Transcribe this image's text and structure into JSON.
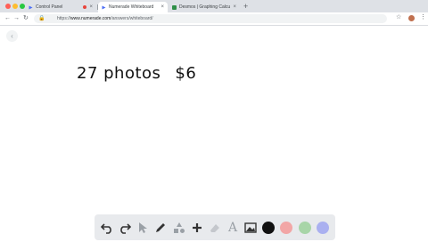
{
  "browser": {
    "tabs": [
      {
        "label": "Control Panel",
        "active": false,
        "dot": true
      },
      {
        "label": "Numerade Whiteboard",
        "active": true,
        "dot": false
      },
      {
        "label": "Desmos | Graphing Calculator",
        "active": false,
        "dot": false
      }
    ],
    "close_glyph": "×",
    "new_tab_glyph": "+",
    "url_prefix": "https://",
    "url_host": "www.numerade.com",
    "url_path": "/answers/whiteboard/",
    "colors": {
      "tabbar": "#dee1e6",
      "numerade_blue": "#4c6ef5",
      "desmos_green": "#2f8f47"
    }
  },
  "whiteboard": {
    "handwriting": [
      "27 photos",
      "$6"
    ],
    "tool_icons": [
      "undo-icon",
      "redo-icon",
      "cursor-icon",
      "pen-icon",
      "shapes-icon",
      "plus-icon",
      "eraser-icon",
      "text-icon",
      "image-icon"
    ],
    "text_tool_glyph": "A",
    "colors": [
      "#111111",
      "#f2a6a6",
      "#a8d5a8",
      "#aab0f0"
    ]
  }
}
